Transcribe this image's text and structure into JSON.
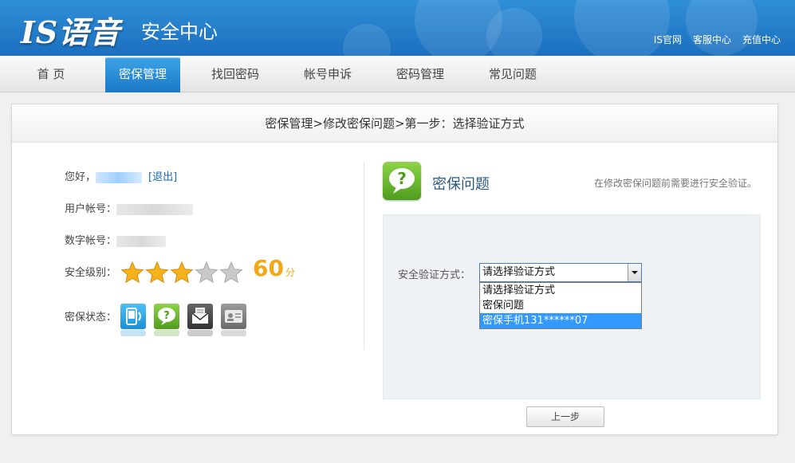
{
  "header": {
    "logo": "IS语音",
    "subtitle": "安全中心",
    "links": [
      "IS官网",
      "客服中心",
      "充值中心"
    ]
  },
  "nav": {
    "tabs": [
      "首 页",
      "密保管理",
      "找回密码",
      "帐号申诉",
      "密码管理",
      "常见问题"
    ],
    "active": "密保管理"
  },
  "breadcrumb": "密保管理>修改密保问题>第一步：选择验证方式",
  "user": {
    "greeting": "您好，",
    "logout": "[退出]",
    "account_label": "用户帐号：",
    "numeric_label": "数字帐号：",
    "level_label": "安全级别：",
    "stars_filled": 3,
    "stars_total": 5,
    "score": "60",
    "score_unit": "分",
    "status_label": "密保状态：",
    "status_icons": [
      "phone-icon",
      "question-icon",
      "email-icon",
      "id-card-icon"
    ]
  },
  "security_question": {
    "title": "密保问题",
    "hint": "在修改密保问题前需要进行安全验证。",
    "verify_label": "安全验证方式：",
    "selected": "请选择验证方式",
    "options": [
      "请选择验证方式",
      "密保问题",
      "密保手机131******07"
    ],
    "highlighted_index": 2
  },
  "buttons": {
    "prev": "上一步"
  },
  "colors": {
    "header_blue": "#1c6fbf",
    "active_tab": "#2a8ad8",
    "score": "#f3a815",
    "question_green": "#6ab733",
    "highlight": "#3399ff"
  }
}
